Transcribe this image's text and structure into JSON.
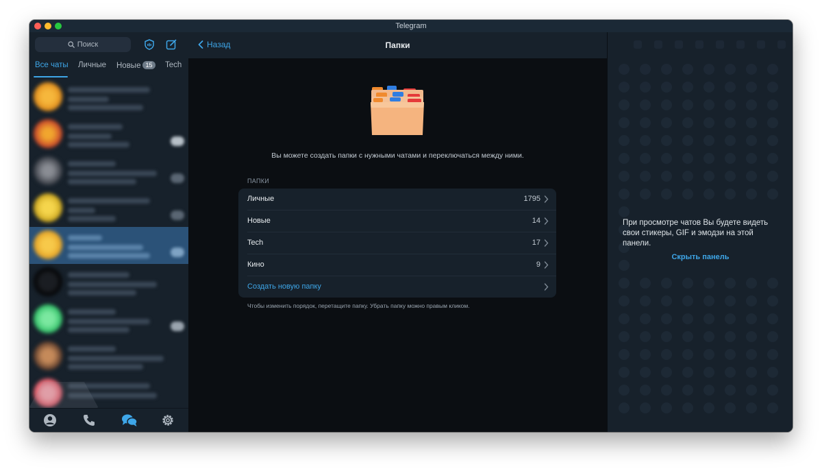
{
  "window": {
    "title": "Telegram"
  },
  "sidebar": {
    "search_placeholder": "Поиск",
    "tabs": [
      {
        "label": "Все чаты",
        "active": true
      },
      {
        "label": "Личные"
      },
      {
        "label": "Новые",
        "badge": "15"
      },
      {
        "label": "Tech"
      }
    ],
    "bottom_nav": [
      "contacts-icon",
      "calls-icon",
      "chats-icon",
      "settings-icon"
    ]
  },
  "main": {
    "back_label": "Назад",
    "title": "Папки",
    "intro_text": "Вы можете создать папки с нужными чатами и переключаться между ними.",
    "section_label": "ПАПКИ",
    "folders": [
      {
        "name": "Личные",
        "count": "1795"
      },
      {
        "name": "Новые",
        "count": "14"
      },
      {
        "name": "Tech",
        "count": "17"
      },
      {
        "name": "Кино",
        "count": "9"
      }
    ],
    "create_label": "Создать новую папку",
    "footnote": "Чтобы изменить порядок, перетащите папку. Убрать папку можно правым кликом."
  },
  "right_panel": {
    "text": "При просмотре чатов Вы будете видеть свои стикеры, GIF и эмодзи на этой панели.",
    "hide_label": "Скрыть панель"
  },
  "colors": {
    "accent": "#3ea6e8",
    "sidebar_bg": "#17212b",
    "main_bg": "#0b0e12",
    "selected_chat": "#2b5278"
  }
}
